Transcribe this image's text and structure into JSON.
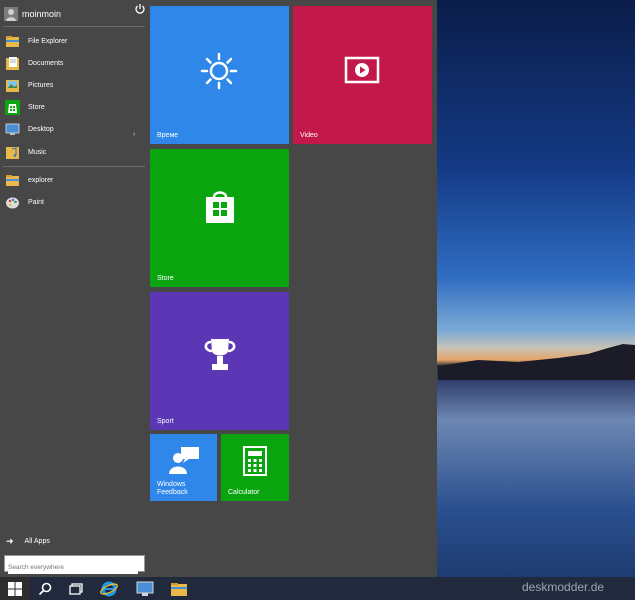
{
  "start_menu": {
    "username": "moinmoin",
    "items": [
      {
        "label": "File Explorer",
        "icon": "file-explorer-icon"
      },
      {
        "label": "Documents",
        "icon": "documents-icon"
      },
      {
        "label": "Pictures",
        "icon": "pictures-icon"
      },
      {
        "label": "Store",
        "icon": "store-icon"
      },
      {
        "label": "Desktop",
        "icon": "desktop-icon"
      },
      {
        "label": "Music",
        "icon": "music-icon"
      }
    ],
    "recent": [
      {
        "label": "explorer",
        "icon": "explorer-icon"
      },
      {
        "label": "Paint",
        "icon": "paint-icon"
      }
    ],
    "all_apps_label": "All Apps",
    "search_placeholder": "Search everywhere"
  },
  "tiles": {
    "weather": {
      "label": "Време",
      "color": "#2e87e9"
    },
    "video": {
      "label": "Video",
      "color": "#c2184a"
    },
    "store": {
      "label": "Store",
      "color": "#0aa40f"
    },
    "sport": {
      "label": "Sport",
      "color": "#5b37b5"
    },
    "feedback": {
      "label": "Windows Feedback",
      "color": "#2e87e9"
    },
    "calculator": {
      "label": "Calculator",
      "color": "#0aa40f"
    }
  },
  "watermark": "deskmodder.de"
}
